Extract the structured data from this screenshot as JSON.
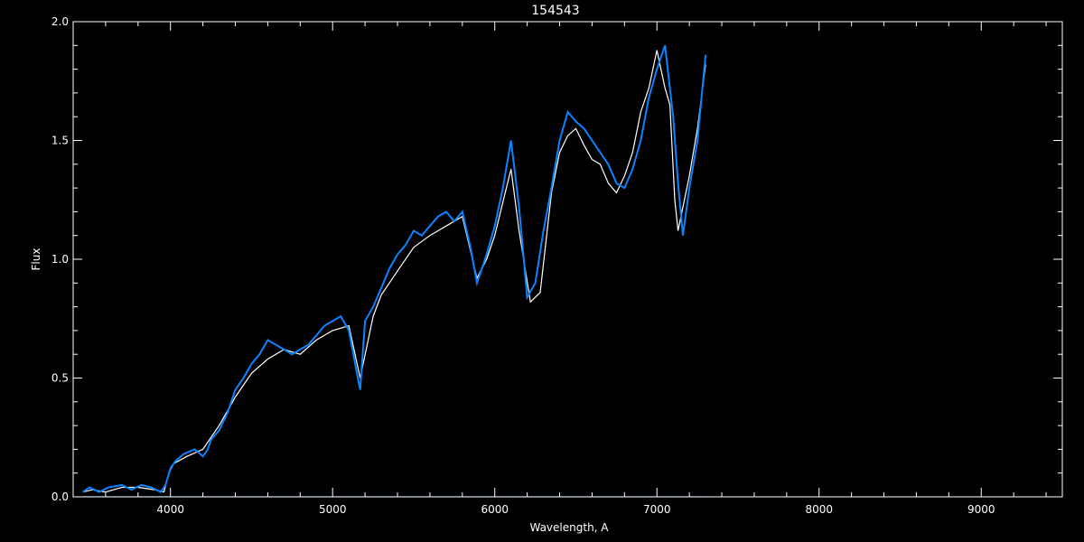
{
  "chart_data": {
    "type": "line",
    "title": "154543",
    "xlabel": "Wavelength, A",
    "ylabel": "Flux",
    "xlim": [
      3400,
      9500
    ],
    "ylim": [
      0.0,
      2.0
    ],
    "xticks": [
      4000,
      5000,
      6000,
      7000,
      8000,
      9000
    ],
    "xtick_labels": [
      "4000",
      "5000",
      "6000",
      "7000",
      "8000",
      "9000"
    ],
    "yticks": [
      0.0,
      0.5,
      1.0,
      1.5,
      2.0
    ],
    "ytick_labels": [
      "0.0",
      "0.5",
      "1.0",
      "1.5",
      "2.0"
    ],
    "grid": false,
    "background": "#000000",
    "axis_color": "#ffffff",
    "series": [
      {
        "color": "#ffffff",
        "x": [
          3460,
          3520,
          3600,
          3700,
          3800,
          3900,
          3960,
          3990,
          4020,
          4100,
          4200,
          4300,
          4400,
          4500,
          4600,
          4700,
          4800,
          4900,
          5000,
          5100,
          5170,
          5250,
          5300,
          5400,
          5500,
          5600,
          5700,
          5800,
          5890,
          5950,
          6000,
          6100,
          6150,
          6220,
          6280,
          6350,
          6400,
          6450,
          6500,
          6550,
          6600,
          6650,
          6700,
          6750,
          6800,
          6850,
          6900,
          6950,
          7000,
          7050,
          7080,
          7110,
          7130,
          7160,
          7200,
          7250,
          7300
        ],
        "y": [
          0.02,
          0.03,
          0.02,
          0.04,
          0.04,
          0.03,
          0.02,
          0.1,
          0.14,
          0.17,
          0.2,
          0.3,
          0.42,
          0.52,
          0.58,
          0.62,
          0.6,
          0.66,
          0.7,
          0.72,
          0.5,
          0.76,
          0.85,
          0.95,
          1.05,
          1.1,
          1.14,
          1.18,
          0.92,
          1.0,
          1.1,
          1.38,
          1.12,
          0.82,
          0.86,
          1.28,
          1.45,
          1.52,
          1.55,
          1.48,
          1.42,
          1.4,
          1.32,
          1.28,
          1.35,
          1.45,
          1.62,
          1.72,
          1.88,
          1.72,
          1.65,
          1.25,
          1.12,
          1.22,
          1.35,
          1.55,
          1.82
        ]
      },
      {
        "color": "#0a84ff",
        "x": [
          3460,
          3500,
          3560,
          3620,
          3700,
          3760,
          3820,
          3880,
          3940,
          3970,
          4000,
          4030,
          4080,
          4150,
          4200,
          4230,
          4250,
          4300,
          4350,
          4400,
          4450,
          4500,
          4550,
          4600,
          4650,
          4700,
          4750,
          4800,
          4850,
          4900,
          4950,
          5000,
          5050,
          5100,
          5150,
          5170,
          5200,
          5250,
          5300,
          5350,
          5400,
          5450,
          5500,
          5550,
          5600,
          5650,
          5700,
          5750,
          5800,
          5850,
          5890,
          5910,
          5950,
          6000,
          6050,
          6100,
          6150,
          6200,
          6250,
          6300,
          6350,
          6400,
          6450,
          6500,
          6550,
          6600,
          6650,
          6700,
          6750,
          6800,
          6850,
          6900,
          6950,
          7000,
          7050,
          7100,
          7130,
          7160,
          7200,
          7250,
          7300
        ],
        "y": [
          0.02,
          0.04,
          0.02,
          0.04,
          0.05,
          0.03,
          0.05,
          0.04,
          0.02,
          0.05,
          0.12,
          0.15,
          0.18,
          0.2,
          0.17,
          0.2,
          0.24,
          0.28,
          0.35,
          0.45,
          0.5,
          0.56,
          0.6,
          0.66,
          0.64,
          0.62,
          0.6,
          0.62,
          0.64,
          0.68,
          0.72,
          0.74,
          0.76,
          0.7,
          0.52,
          0.45,
          0.74,
          0.8,
          0.88,
          0.96,
          1.02,
          1.06,
          1.12,
          1.1,
          1.14,
          1.18,
          1.2,
          1.16,
          1.2,
          1.05,
          0.9,
          0.94,
          1.02,
          1.14,
          1.3,
          1.5,
          1.22,
          0.84,
          0.9,
          1.12,
          1.3,
          1.5,
          1.62,
          1.58,
          1.55,
          1.5,
          1.45,
          1.4,
          1.32,
          1.3,
          1.38,
          1.5,
          1.68,
          1.8,
          1.9,
          1.6,
          1.32,
          1.1,
          1.3,
          1.5,
          1.86
        ]
      },
      {
        "color": "#0a84ff",
        "x": [
          3460,
          7300
        ],
        "y": [
          0.0,
          0.0
        ]
      }
    ]
  }
}
